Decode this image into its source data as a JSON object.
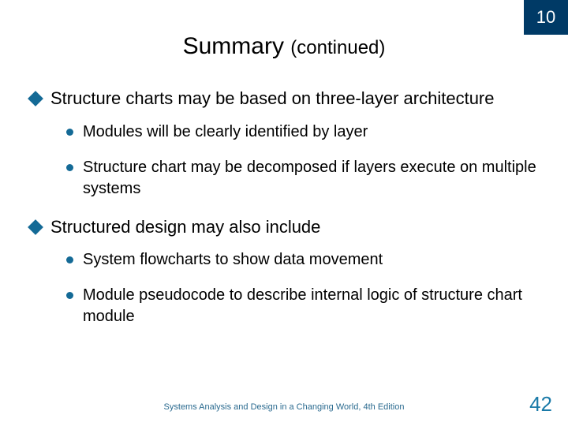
{
  "chapter_number": "10",
  "title_main": "Summary",
  "title_suffix": "(continued)",
  "bullets": [
    {
      "text": "Structure charts may be based on three-layer architecture",
      "sub": [
        "Modules will be clearly identified by layer",
        "Structure chart may be decomposed if layers execute on multiple systems"
      ]
    },
    {
      "text": "Structured design may also include",
      "sub": [
        "System flowcharts to show data movement",
        "Module pseudocode to describe internal logic of structure chart module"
      ]
    }
  ],
  "footer_text": "Systems Analysis and Design in a Changing World, 4th Edition",
  "page_number": "42"
}
